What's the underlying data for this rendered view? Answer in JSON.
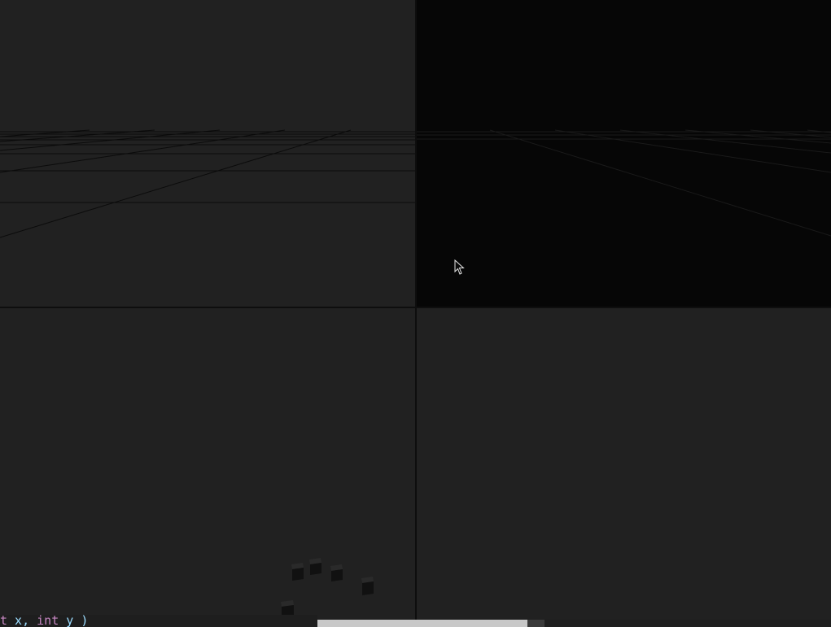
{
  "viewports": [
    {
      "id": "top-left",
      "view": "perspective-grid"
    },
    {
      "id": "top-right",
      "view": "perspective-grid-dark"
    },
    {
      "id": "bottom-left",
      "view": "cubes"
    },
    {
      "id": "bottom-right",
      "view": "empty"
    }
  ],
  "code_fragment": {
    "keyword1": "t",
    "text1": " x, ",
    "keyword2": "int",
    "text2": " y )"
  },
  "icons": {
    "cursor": "mouse-pointer-icon"
  },
  "colors": {
    "viewport_bg": "#212121",
    "viewport_dark_bg": "#060606",
    "divider": "#0e0e0e",
    "grid_line": "#0a0a0a",
    "scroll_thumb": "#c8c8c8"
  }
}
